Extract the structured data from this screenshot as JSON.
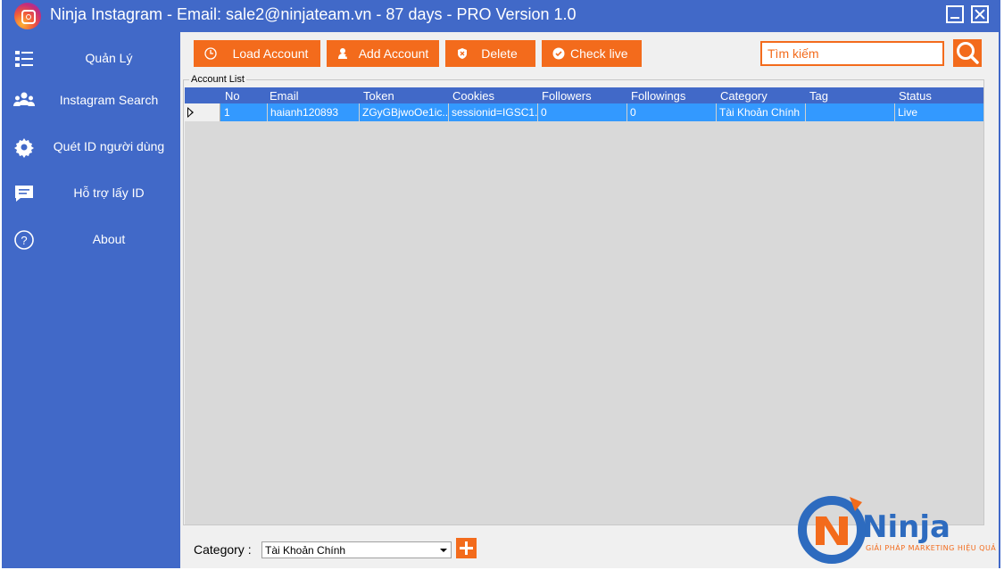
{
  "window": {
    "title": "Ninja Instagram - Email: sale2@ninjateam.vn - 87 days - PRO Version 1.0"
  },
  "sidebar": {
    "items": [
      {
        "label": "Quản Lý",
        "icon": "list-icon"
      },
      {
        "label": "Instagram Search",
        "icon": "users-icon"
      },
      {
        "label": "Quét ID người dùng",
        "icon": "gear-icon"
      },
      {
        "label": "Hỗ trợ lấy ID",
        "icon": "chat-icon"
      },
      {
        "label": "About",
        "icon": "question-icon"
      }
    ]
  },
  "toolbar": {
    "load_label": "Load Account",
    "add_label": "Add Account",
    "delete_label": "Delete",
    "check_label": "Check live",
    "search_placeholder": "Tìm kiếm"
  },
  "account_list": {
    "legend": "Account List",
    "columns": [
      "No",
      "Email",
      "Token",
      "Cookies",
      "Followers",
      "Followings",
      "Category",
      "Tag",
      "Status"
    ],
    "rows": [
      {
        "no": "1",
        "email": "haianh120893",
        "token": "ZGyGBjwoOe1ic...",
        "cookies": "sessionid=IGSC1...",
        "followers": "0",
        "followings": "0",
        "category": "Tài Khoản Chính",
        "tag": "",
        "status": "Live"
      }
    ]
  },
  "category": {
    "label": "Category :",
    "selected": "Tài Khoản Chính"
  },
  "brand": {
    "name": "Ninja",
    "tagline": "GIẢI PHÁP MARKETING HIỆU QUẢ"
  },
  "colors": {
    "primary_blue": "#4169c8",
    "accent_orange": "#f36b1c",
    "selected_row": "#3399ff"
  }
}
